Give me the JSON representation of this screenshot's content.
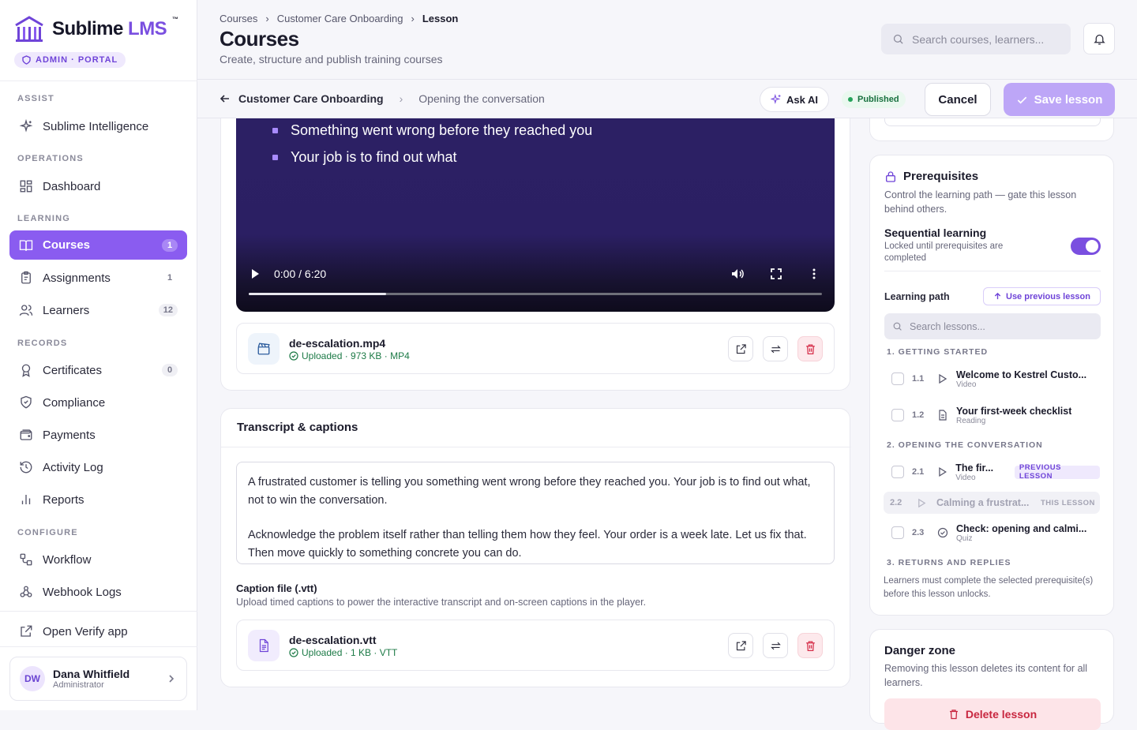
{
  "app": {
    "name_part1": "Sublime ",
    "name_part2": "LMS",
    "tm": "™",
    "portal": "ADMIN · PORTAL"
  },
  "sidebar": {
    "sections": {
      "assist": "ASSIST",
      "operations": "OPERATIONS",
      "learning": "LEARNING",
      "records": "RECORDS",
      "configure": "CONFIGURE"
    },
    "items": [
      {
        "label": "Sublime Intelligence"
      },
      {
        "label": "Dashboard"
      },
      {
        "label": "Courses",
        "count": "1"
      },
      {
        "label": "Assignments",
        "count": "1"
      },
      {
        "label": "Learners",
        "count": "12"
      },
      {
        "label": "Certificates",
        "count": "0"
      },
      {
        "label": "Compliance"
      },
      {
        "label": "Payments"
      },
      {
        "label": "Activity Log"
      },
      {
        "label": "Reports"
      },
      {
        "label": "Workflow"
      },
      {
        "label": "Webhook Logs"
      },
      {
        "label": "Open Verify app"
      }
    ],
    "user": {
      "initials": "DW",
      "name": "Dana Whitfield",
      "role": "Administrator"
    }
  },
  "header": {
    "breadcrumb": [
      "Courses",
      "Customer Care Onboarding",
      "Lesson"
    ],
    "title": "Courses",
    "subtitle": "Create, structure and publish training courses",
    "search_placeholder": "Search courses, learners..."
  },
  "toolbar": {
    "course": "Customer Care Onboarding",
    "lesson": "Opening the conversation",
    "ask_ai": "Ask AI",
    "status": "Published",
    "cancel": "Cancel",
    "save": "Save lesson"
  },
  "video": {
    "bullets": [
      "Something went wrong before they reached you",
      "Your job is to find out what"
    ],
    "time": "0:00 / 6:20",
    "progress": 0.24
  },
  "video_file": {
    "name": "de-escalation.mp4",
    "meta": "Uploaded · 973 KB · MP4"
  },
  "transcript": {
    "title": "Transcript & captions",
    "text_p1": "A frustrated customer is telling you something went wrong before they reached you. Your job is to find out what, not to win the conversation.",
    "text_p2": "Acknowledge the problem itself rather than telling them how they feel. Your order is a week late. Let us fix that. Then move quickly to something concrete you can do.",
    "caption_label": "Caption file (.vtt)",
    "caption_help": "Upload timed captions to power the interactive transcript and on-screen captions in the player.",
    "caption_file": {
      "name": "de-escalation.vtt",
      "meta": "Uploaded · 1 KB · VTT"
    }
  },
  "prereq": {
    "title": "Prerequisites",
    "desc": "Control the learning path — gate this lesson behind others.",
    "seq_title": "Sequential learning",
    "seq_desc": "Locked until prerequisites are completed",
    "seq_on": true,
    "path_label": "Learning path",
    "use_prev": "Use previous lesson",
    "search_placeholder": "Search lessons...",
    "modules": [
      "1. GETTING STARTED",
      "2. OPENING THE CONVERSATION",
      "3. RETURNS AND REPLIES"
    ],
    "lessons": [
      {
        "num": "1.1",
        "title": "Welcome to Kestrel Custo...",
        "type": "Video"
      },
      {
        "num": "1.2",
        "title": "Your first-week checklist",
        "type": "Reading"
      },
      {
        "num": "2.1",
        "title": "The fir...",
        "type": "Video",
        "tag": "PREVIOUS LESSON"
      },
      {
        "num": "2.2",
        "title": "Calming a frustrat...",
        "tag": "THIS LESSON"
      },
      {
        "num": "2.3",
        "title": "Check: opening and calmi...",
        "type": "Quiz"
      }
    ],
    "footer": "Learners must complete the selected prerequisite(s) before this lesson unlocks."
  },
  "danger": {
    "title": "Danger zone",
    "desc": "Removing this lesson deletes its content for all learners.",
    "button": "Delete lesson"
  }
}
